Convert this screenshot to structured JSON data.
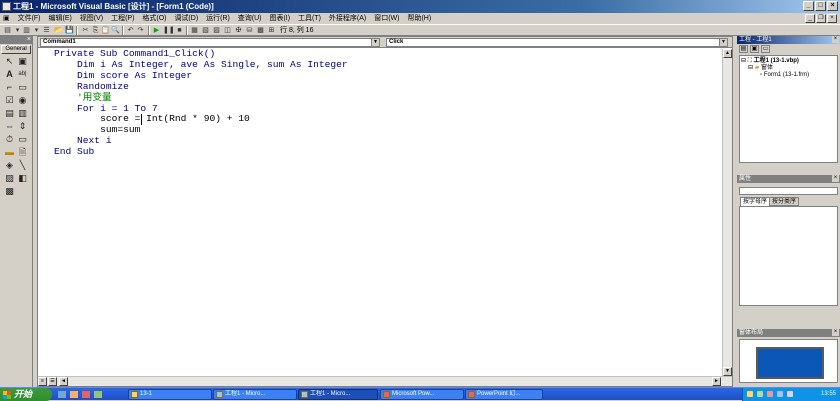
{
  "window": {
    "title": "工程1 - Microsoft Visual Basic [设计] - [Form1 (Code)]"
  },
  "menu": {
    "items": [
      "文件(F)",
      "编辑(E)",
      "视图(V)",
      "工程(P)",
      "格式(O)",
      "调试(D)",
      "运行(R)",
      "查询(U)",
      "图表(I)",
      "工具(T)",
      "外接程序(A)",
      "窗口(W)",
      "帮助(H)"
    ]
  },
  "toolbar": {
    "position_text": "行 8, 列 16"
  },
  "toolbox": {
    "tab_label": "General"
  },
  "code_window": {
    "object_combo": "Command1",
    "procedure_combo": "Click",
    "lines": [
      {
        "kw": "Private Sub ",
        "rest": "Command1_Click()",
        "indent": ""
      },
      {
        "kw": "Dim ",
        "rest": "i As Integer, ave As Single, sum As Integer",
        "indent": "    "
      },
      {
        "kw": "Dim ",
        "rest": "score As Integer",
        "indent": "    "
      },
      {
        "kw": "Randomize",
        "rest": "",
        "indent": "    "
      },
      {
        "kw": "'用变量",
        "rest": "",
        "indent": "    ",
        "comment": true
      },
      {
        "kw": "For ",
        "rest": "i = 1 To 7",
        "indent": "    "
      },
      {
        "kw": "",
        "rest": "score = Int(Rnd * 90) + 10",
        "indent": "        ",
        "plain": true
      },
      {
        "kw": "",
        "rest": "sum=sum",
        "indent": "        ",
        "plain": true
      },
      {
        "kw": "Next ",
        "rest": "i",
        "indent": "    "
      },
      {
        "kw": "End Sub",
        "rest": "",
        "indent": ""
      }
    ]
  },
  "project_panel": {
    "title": "工程 - 工程1",
    "root": "工程1 (13-1.vbp)",
    "folder": "窗体",
    "form": "Form1 (13-1.frm)"
  },
  "properties_panel": {
    "title": "属性",
    "tabs": [
      "按字母序",
      "按分类序"
    ]
  },
  "layout_panel": {
    "title": "窗体布局"
  },
  "taskbar": {
    "start_label": "开始",
    "tasks": [
      "13-1",
      "工程1 - Micro...",
      "工程1 - Micro...",
      "Microsoft Pow...",
      "PowerPoint 幻..."
    ],
    "clock": "13:55"
  },
  "colors": {
    "title_bar": "#0a246a",
    "keyword": "#00008b",
    "comment": "#008000",
    "taskbar": "#245edb",
    "start_button": "#2f8f2f"
  }
}
